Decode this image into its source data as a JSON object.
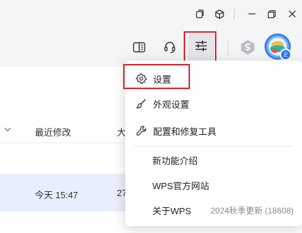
{
  "window_controls": [
    {
      "name": "tile-windows-icon"
    },
    {
      "name": "cube-icon"
    },
    {
      "name": "minimize-icon"
    },
    {
      "name": "restore-icon"
    },
    {
      "name": "close-icon"
    }
  ],
  "toolbar": {
    "icons": [
      "reading-mode-icon",
      "headset-icon",
      "settings-sliders-icon",
      "wps-logo-icon",
      "avatar"
    ],
    "avatar_badge": "企"
  },
  "file_list": {
    "columns": [
      "最近修改",
      "大"
    ],
    "rows": [
      {
        "modified": "今天 15:47",
        "size_partial": "27"
      }
    ]
  },
  "menu": {
    "items": [
      {
        "label": "设置",
        "icon": "gear-icon"
      },
      {
        "label": "外观设置",
        "icon": "brush-icon"
      },
      {
        "label": "配置和修复工具",
        "icon": "wrench-icon"
      },
      {
        "label": "新功能介绍"
      },
      {
        "label": "WPS官方网站"
      },
      {
        "label": "关于WPS",
        "meta": "2024秋季更新 (18608)"
      }
    ]
  },
  "colors": {
    "highlight_box": "#e0202a",
    "selected_row": "#e8eefb",
    "accent": "#2a6cf0"
  }
}
